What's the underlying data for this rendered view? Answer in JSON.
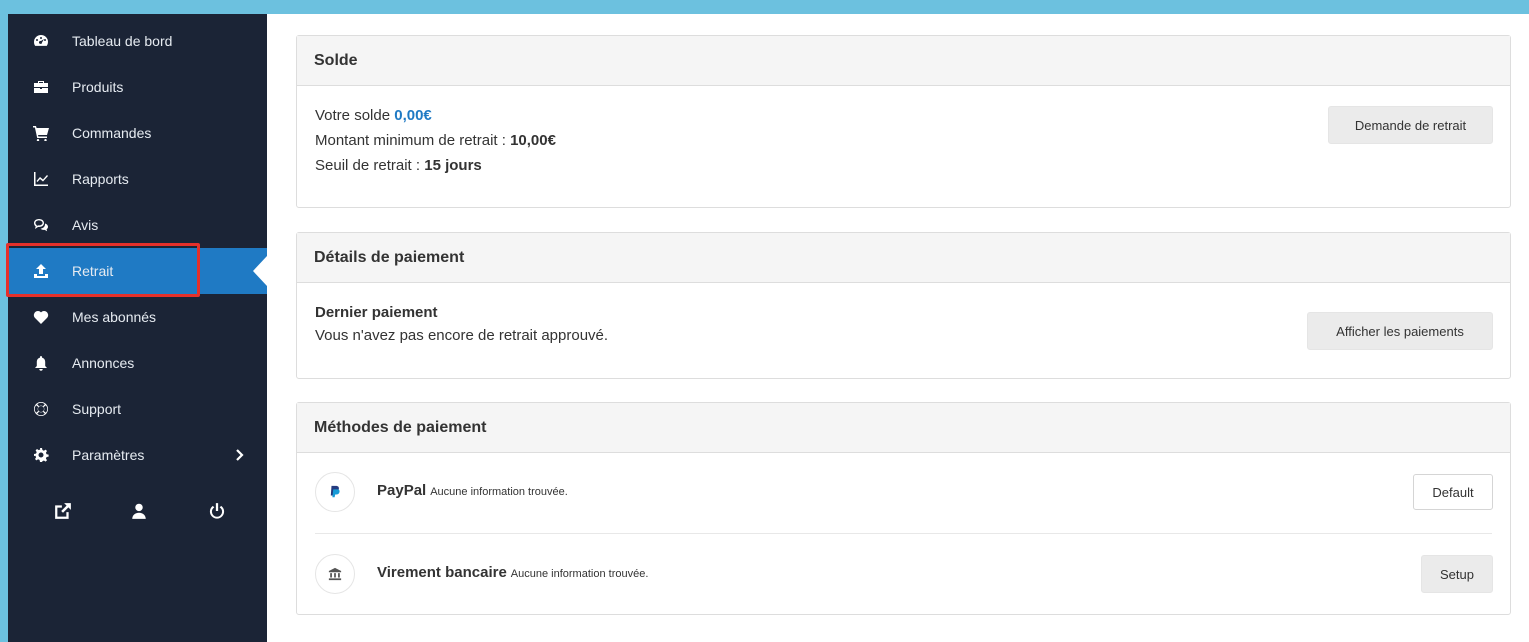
{
  "sidebar": {
    "items": [
      {
        "label": "Tableau de bord",
        "icon": "dashboard-icon"
      },
      {
        "label": "Produits",
        "icon": "briefcase-icon"
      },
      {
        "label": "Commandes",
        "icon": "cart-icon"
      },
      {
        "label": "Rapports",
        "icon": "chart-icon"
      },
      {
        "label": "Avis",
        "icon": "comments-icon"
      },
      {
        "label": "Retrait",
        "icon": "upload-icon"
      },
      {
        "label": "Mes abonnés",
        "icon": "heart-icon"
      },
      {
        "label": "Annonces",
        "icon": "bell-icon"
      },
      {
        "label": "Support",
        "icon": "lifebuoy-icon"
      },
      {
        "label": "Paramètres",
        "icon": "gear-icon"
      }
    ],
    "active_item": "Retrait",
    "bottom_icons": [
      "external-link-icon",
      "user-icon",
      "power-icon"
    ]
  },
  "balance_panel": {
    "title": "Solde",
    "balance_label": "Votre solde",
    "balance_value": "0,00€",
    "min_label": "Montant minimum de retrait :",
    "min_value": "10,00€",
    "threshold_label": "Seuil de retrait :",
    "threshold_value": "15 jours",
    "withdraw_button": "Demande de retrait"
  },
  "payment_details_panel": {
    "title": "Détails de paiement",
    "last_payment_heading": "Dernier paiement",
    "last_payment_text": "Vous n'avez pas encore de retrait approuvé.",
    "view_payments_button": "Afficher les paiements"
  },
  "payment_methods_panel": {
    "title": "Méthodes de paiement",
    "methods": [
      {
        "name": "PayPal",
        "status": "Aucune information trouvée.",
        "button": "Default",
        "icon": "paypal-icon"
      },
      {
        "name": "Virement bancaire",
        "status": "Aucune information trouvée.",
        "button": "Setup",
        "icon": "bank-icon"
      }
    ]
  },
  "colors": {
    "sidebar_bg": "#1b2436",
    "active_bg": "#1f7ac4",
    "accent": "#1f7ac4",
    "highlight_border": "#e5302a",
    "page_border": "#6cc1df"
  }
}
